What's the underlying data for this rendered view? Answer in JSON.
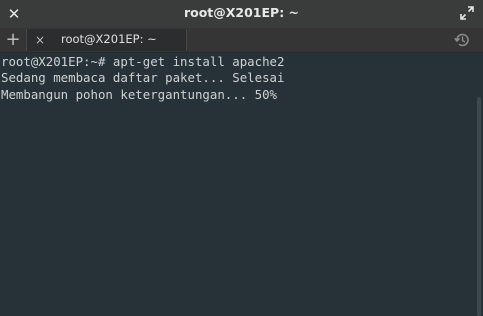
{
  "window": {
    "title": "root@X201EP: ~",
    "close_icon": "close-icon",
    "maximize_icon": "maximize-icon"
  },
  "tabs": {
    "new_tab_glyph": "+",
    "items": [
      {
        "label": "root@X201EP: ~",
        "close_glyph": "×"
      }
    ],
    "history_icon": "history-icon"
  },
  "terminal": {
    "lines": [
      "root@X201EP:~# apt-get install apache2",
      "Sedang membaca daftar paket... Selesai",
      "Membangun pohon ketergantungan... 50%"
    ]
  },
  "colors": {
    "background": "#263238",
    "titlebar": "#3a3b3b",
    "text": "#cfd2d2"
  }
}
